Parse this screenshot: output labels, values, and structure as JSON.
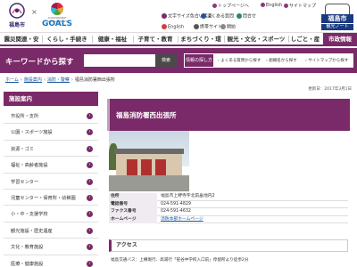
{
  "header": {
    "city_name": "福島市",
    "sdg_x": "×",
    "sdg_small": "SUSTAINABLE DEVELOPMENT",
    "sdg_goals": "GOALS",
    "top_links": [
      "トップページへ",
      "English",
      "サイトマップ"
    ],
    "tools_row1": [
      "文字サイズ色合い変更",
      "よくある質問",
      "問合せ"
    ],
    "tools_row2": [
      "English",
      "携帯サイト",
      "開始"
    ],
    "mascot_label": "福島市",
    "mascot_sub": "観光ノート"
  },
  "nav": {
    "items": [
      "震災関連・安全",
      "くらし・手続き",
      "健康・福祉",
      "子育て・教育",
      "まちづくり・環境",
      "観光・文化・スポーツ",
      "しごと・産業",
      "市政情報"
    ],
    "active_index": 7
  },
  "search": {
    "title": "キーワードから探す",
    "input_value": "",
    "button_label": "検索",
    "find_label": "情報の探し方",
    "find_links": [
      "よくある質問から探す",
      "組織名から探す",
      "サイトマップから探す"
    ]
  },
  "breadcrumb": [
    "ホーム",
    "施設案内",
    "消防・警察",
    "福島消防署西出張所"
  ],
  "updated": "更新日：2017年3月1日",
  "sidebar": {
    "title": "施設案内",
    "items": [
      "市役所・支所",
      "公園・スポーツ施設",
      "資源・ゴミ",
      "福祉・高齢者施設",
      "学習センター",
      "児童センター・保育所・幼稚園",
      "小・中・支援学校",
      "観光施設・歴史遺産",
      "文化・教育施設",
      "医療・健康施設"
    ]
  },
  "main": {
    "title": "福島消防署西出張所",
    "info": [
      {
        "key": "住所",
        "value": "福島市上野寺字北前畠地内2",
        "link": false
      },
      {
        "key": "電話番号",
        "value": "024-591-4829",
        "link": false
      },
      {
        "key": "ファクス番号",
        "value": "024-591-4632",
        "link": false
      },
      {
        "key": "ホームページ",
        "value": "消防本部ホームページ",
        "link": true
      }
    ],
    "access_title": "アクセス",
    "access_text": "福島交通バス：上横堀行、高湯行「笹谷中学校入口前」停留所より徒歩2分"
  },
  "colors": {
    "brand": "#7a2a68",
    "link": "#1a55a0"
  }
}
